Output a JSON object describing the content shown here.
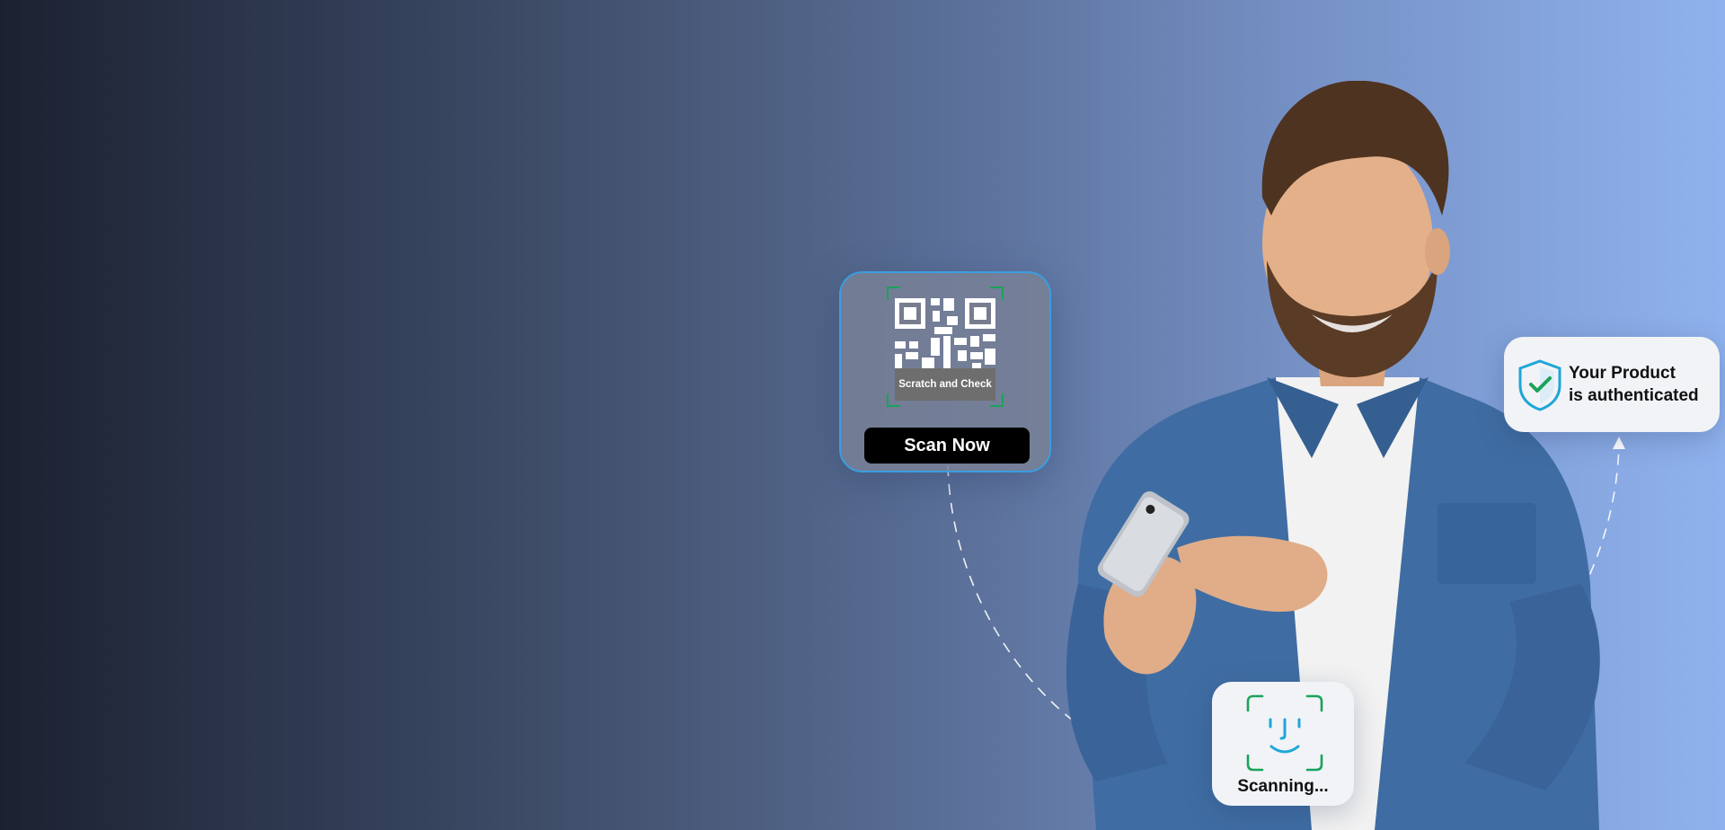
{
  "qr_card": {
    "label": "Scratch and Check",
    "button_label": "Scan Now"
  },
  "auth_card": {
    "line1": "Your Product",
    "line2": "is authenticated"
  },
  "scan_card": {
    "status": "Scanning..."
  },
  "colors": {
    "accent_green": "#1aa35a",
    "accent_blue": "#1fa6d8",
    "card_bg": "#f1f3f7",
    "button_bg": "#000000"
  },
  "icons": [
    "qr-code-icon",
    "shield-check-icon",
    "face-id-icon"
  ]
}
